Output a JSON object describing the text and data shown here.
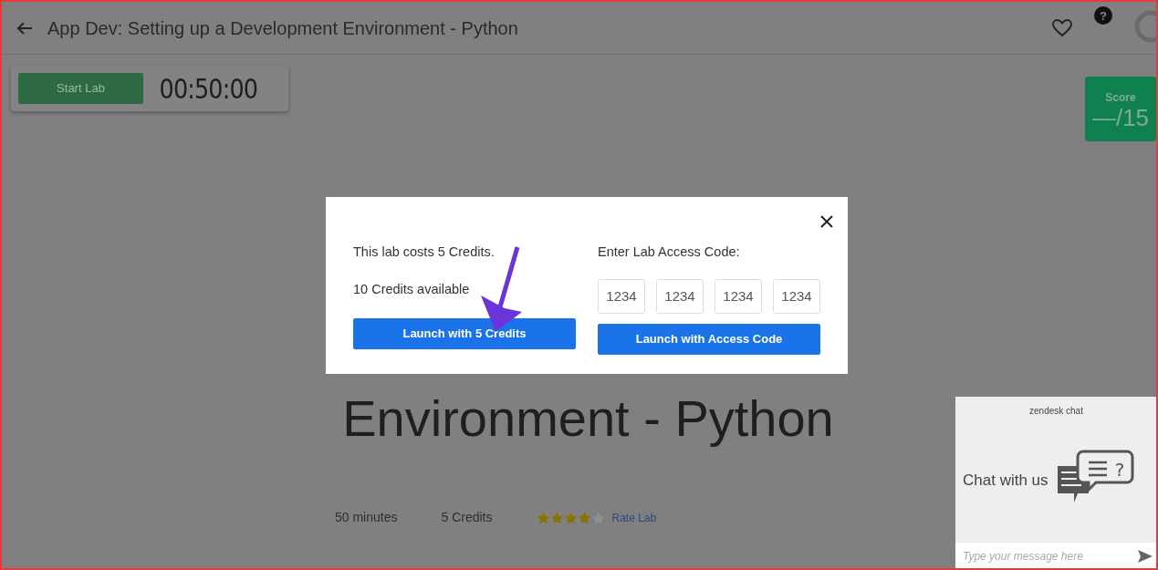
{
  "header": {
    "title": "App Dev: Setting up a Development Environment - Python"
  },
  "lab_bar": {
    "start_button": "Start Lab",
    "timer": "00:50:00"
  },
  "help_icon": "?",
  "score": {
    "label": "Score",
    "value": "—/15"
  },
  "lab_title": "Environment - Python",
  "meta": {
    "duration": "50 minutes",
    "cost": "5 Credits",
    "stars": 4,
    "rate_link": "Rate Lab"
  },
  "modal": {
    "cost_text": "This lab costs 5 Credits.",
    "available_text": "10 Credits available",
    "launch_credits_button": "Launch with 5 Credits",
    "code_label": "Enter Lab Access Code:",
    "code_fields": [
      {
        "placeholder": "1234"
      },
      {
        "placeholder": "1234"
      },
      {
        "placeholder": "1234"
      },
      {
        "placeholder": "1234"
      }
    ],
    "launch_code_button": "Launch with Access Code"
  },
  "chat": {
    "brand": "zendesk chat",
    "icon_mark": "?",
    "heading": "Chat with us",
    "input": {
      "placeholder": "Type your message here"
    }
  }
}
